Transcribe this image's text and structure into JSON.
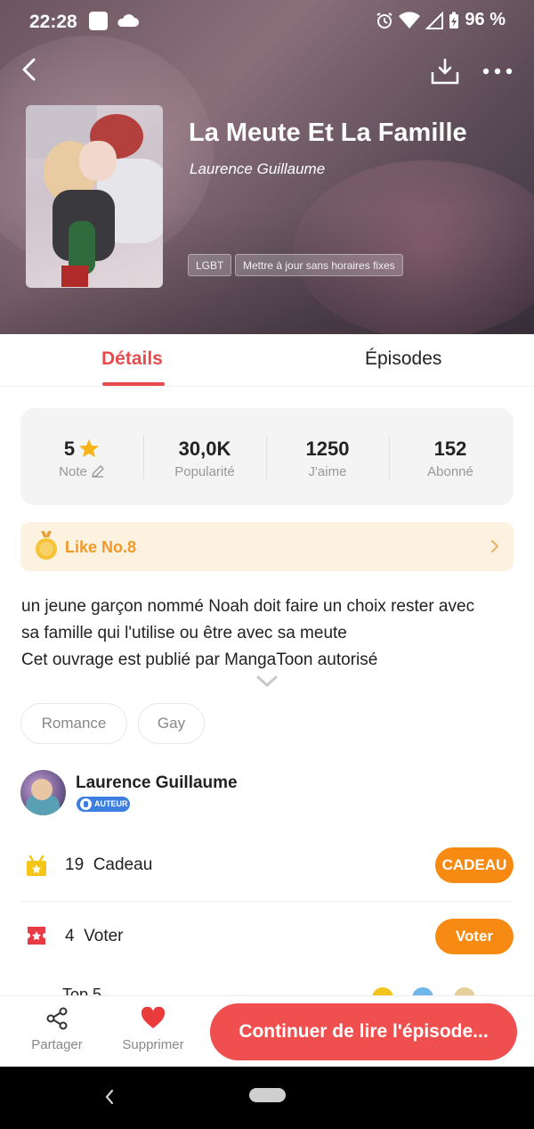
{
  "status_bar": {
    "time": "22:28",
    "battery": "96 %"
  },
  "book": {
    "title": "La Meute Et La Famille",
    "author": "Laurence Guillaume",
    "tags": [
      "LGBT",
      "Mettre à jour sans horaires fixes"
    ]
  },
  "tabs": [
    {
      "label": "Détails",
      "active": true
    },
    {
      "label": "Épisodes",
      "active": false
    }
  ],
  "stats": [
    {
      "value": "5",
      "label": "Note"
    },
    {
      "value": "30,0K",
      "label": "Popularité"
    },
    {
      "value": "1250",
      "label": "J'aime"
    },
    {
      "value": "152",
      "label": "Abonné"
    }
  ],
  "rank": {
    "label": "Like No.8"
  },
  "description": {
    "lines": [
      "un jeune garçon nommé Noah doit faire un choix rester avec",
      "sa famille qui l'utilise ou être avec sa meute",
      "Cet ouvrage est publié par MangaToon  autorisé"
    ]
  },
  "genres": [
    "Romance",
    "Gay"
  ],
  "author_block": {
    "name": "Laurence Guillaume",
    "badge": "AUTEUR"
  },
  "actions": {
    "gift": {
      "count": "19",
      "label": "Cadeau",
      "button": "CADEAU"
    },
    "vote": {
      "count": "4",
      "label": "Voter",
      "button": "Voter"
    }
  },
  "peek_row": {
    "text": "Top 5"
  },
  "bottom_bar": {
    "share_label": "Partager",
    "unfavorite_label": "Supprimer",
    "continue_label": "Continuer de lire l'épisode..."
  },
  "colors": {
    "accent": "#e94a4c",
    "cta": "#f04f50",
    "orange_button": "#f78a13",
    "rank_text": "#f0992a",
    "rank_bg": "#fdf2df"
  }
}
